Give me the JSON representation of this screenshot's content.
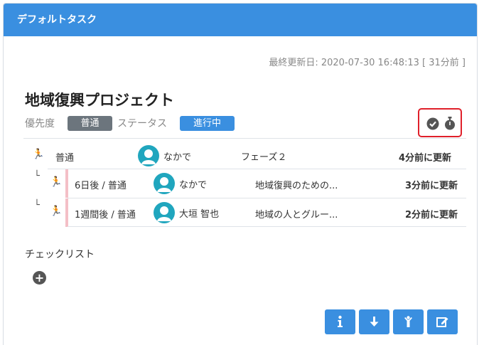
{
  "panel": {
    "title": "デフォルトタスク"
  },
  "updated": {
    "text": "最終更新日: 2020-07-30 16:48:13 [ 31分前 ]"
  },
  "project": {
    "title": "地域復興プロジェクト",
    "priority_label": "優先度",
    "priority_value": "普通",
    "status_label": "ステータス",
    "status_value": "進行中"
  },
  "header_icons": [
    "check-circle-icon",
    "stopwatch-icon"
  ],
  "tasks": [
    {
      "indent": "",
      "runner": "🏃",
      "col1": "普通",
      "assignee": "なかで",
      "col3": "フェーズ２",
      "updated": "4分前に更新"
    },
    {
      "indent": "└",
      "runner": "🏃",
      "col1": "6日後 / 普通",
      "assignee": "なかで",
      "col3": "地域復興のための...",
      "updated": "3分前に更新"
    },
    {
      "indent": "└",
      "runner": "🏃",
      "col1": "1週間後 / 普通",
      "assignee": "大垣 智也",
      "col3": "地域の人とグルー...",
      "updated": "2分前に更新"
    }
  ],
  "checklist": {
    "label": "チェックリスト",
    "add_icon": "+"
  },
  "actions": [
    "info-icon",
    "arrow-down-icon",
    "person-icon",
    "edit-icon"
  ],
  "colors": {
    "accent": "#3a8fe0",
    "avatar": "#20a6be",
    "badge_gray": "#6c757d",
    "highlight": "#e0202a",
    "child_bar": "#f4bfc7"
  }
}
